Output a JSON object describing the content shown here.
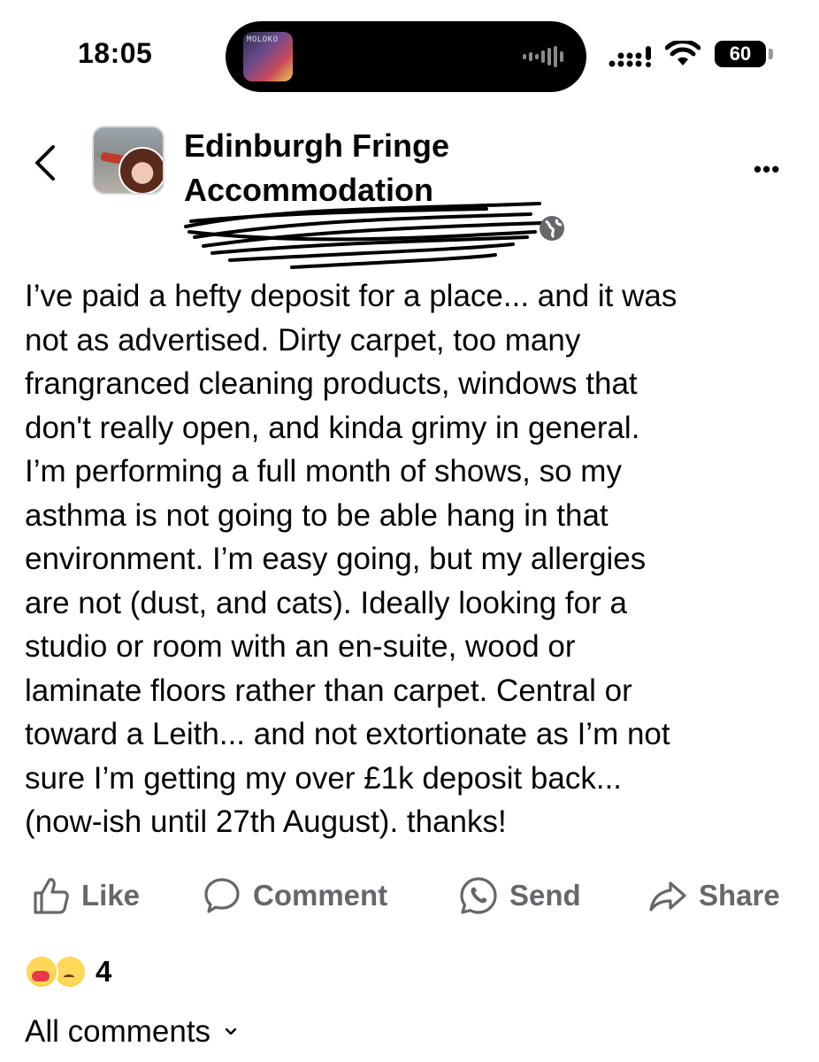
{
  "status_bar": {
    "time": "18:05",
    "island_thumbnail_text": "MOLOKO",
    "battery": "60"
  },
  "header": {
    "group_name": "Edinburgh Fringe Accommodation",
    "back_icon": "chevron-left-icon",
    "more_icon": "more-horizontal-icon",
    "audience_icon": "globe-icon"
  },
  "post": {
    "text": "I’ve paid a hefty deposit for a place... and it was\nnot as advertised. Dirty carpet, too many\nfrangranced cleaning products, windows that\ndon't really open, and kinda grimy in general.\nI’m performing a full month of shows, so my\nasthma is not going to be able hang in that\nenvironment.  I’m easy going, but my allergies\nare not (dust, and cats). Ideally looking for a\nstudio or room with an en-suite, wood or\nlaminate floors rather than carpet. Central or\ntoward a Leith... and not extortionate as I’m not\nsure I’m getting my over £1k deposit back...\n(now-ish until 27th August). thanks!"
  },
  "actions": {
    "like": "Like",
    "comment": "Comment",
    "send": "Send",
    "share": "Share"
  },
  "reactions": {
    "count": "4",
    "types": [
      "care",
      "sad"
    ]
  },
  "comments": {
    "filter_label": "All comments"
  },
  "colors": {
    "text": "#050505",
    "secondary": "#65676b"
  }
}
